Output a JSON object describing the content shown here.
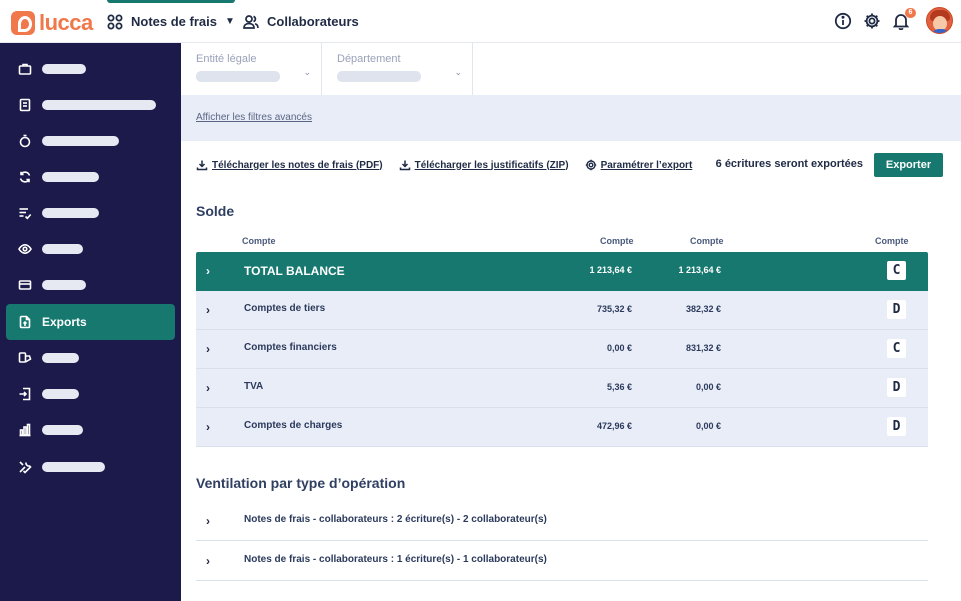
{
  "topbar": {
    "logo_text": "lucca",
    "nav": [
      {
        "label": "Notes de frais",
        "icon": "apps-grid-icon",
        "has_dropdown": true
      },
      {
        "label": "Collaborateurs",
        "icon": "users-icon",
        "has_dropdown": false
      }
    ],
    "notification_count": "6",
    "icons": [
      "help-icon",
      "settings-icon",
      "bell-icon"
    ]
  },
  "sidebar": {
    "active_label": "Exports",
    "items": [
      {
        "icon": "briefcase-icon"
      },
      {
        "icon": "receipt-icon"
      },
      {
        "icon": "stopwatch-icon"
      },
      {
        "icon": "sync-icon"
      },
      {
        "icon": "checklist-icon"
      },
      {
        "icon": "eye-icon"
      },
      {
        "icon": "credit-card-icon"
      },
      {
        "icon": "export-icon",
        "label": "Exports"
      },
      {
        "icon": "payment-icon"
      },
      {
        "icon": "import-icon"
      },
      {
        "icon": "chart-bar-icon"
      },
      {
        "icon": "tools-icon"
      }
    ]
  },
  "filters": {
    "entity_label": "Entité légale",
    "department_label": "Département",
    "advanced_link": "Afficher les filtres avancés"
  },
  "actions": {
    "download_pdf": "Télécharger les notes de frais (PDF)",
    "download_zip": "Télécharger les justificatifs (ZIP)",
    "configure": "Paramétrer l’export",
    "count_text": "6 écritures seront exportées",
    "export_button": "Exporter"
  },
  "solde": {
    "title": "Solde",
    "headers": [
      "Compte",
      "Compte",
      "Compte",
      "Compte"
    ],
    "rows": [
      {
        "name": "TOTAL BALANCE",
        "v1": "1 213,64 €",
        "v2": "1 213,64 €",
        "dc": "C"
      },
      {
        "name": "Comptes de tiers",
        "v1": "735,32 €",
        "v2": "382,32 €",
        "dc": "D"
      },
      {
        "name": "Comptes financiers",
        "v1": "0,00 €",
        "v2": "831,32 €",
        "dc": "C"
      },
      {
        "name": "TVA",
        "v1": "5,36 €",
        "v2": "0,00 €",
        "dc": "D"
      },
      {
        "name": "Comptes de charges",
        "v1": "472,96 €",
        "v2": "0,00 €",
        "dc": "D"
      }
    ]
  },
  "ventilation": {
    "title": "Ventilation par type d’opération",
    "rows": [
      "Notes de frais - collaborateurs : 2 écriture(s) - 2 collaborateur(s)",
      "Notes de frais - collaborateurs : 1 écriture(s) - 1 collaborateur(s)"
    ]
  },
  "colors": {
    "accent": "#16786f",
    "sidebar_bg": "#1b1a4a",
    "brand": "#f0784b",
    "band_bg": "#e9edf7"
  }
}
